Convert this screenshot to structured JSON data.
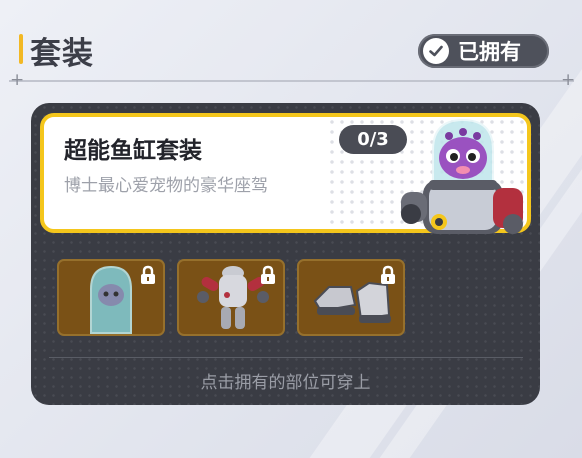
{
  "header": {
    "title": "套装",
    "owned_button_label": "已拥有"
  },
  "set_card": {
    "name": "超能鱼缸套装",
    "description": "博士最心爱宠物的豪华座驾",
    "progress": "0/3"
  },
  "parts": [
    {
      "icon": "fish-tank-helmet-icon",
      "locked": true
    },
    {
      "icon": "robot-suit-icon",
      "locked": true
    },
    {
      "icon": "robot-shoes-icon",
      "locked": true
    }
  ],
  "hint_text": "点击拥有的部位可穿上",
  "colors": {
    "accent_yellow": "#f4c61c",
    "panel": "#3a3c44",
    "slot": "#7a5116"
  }
}
